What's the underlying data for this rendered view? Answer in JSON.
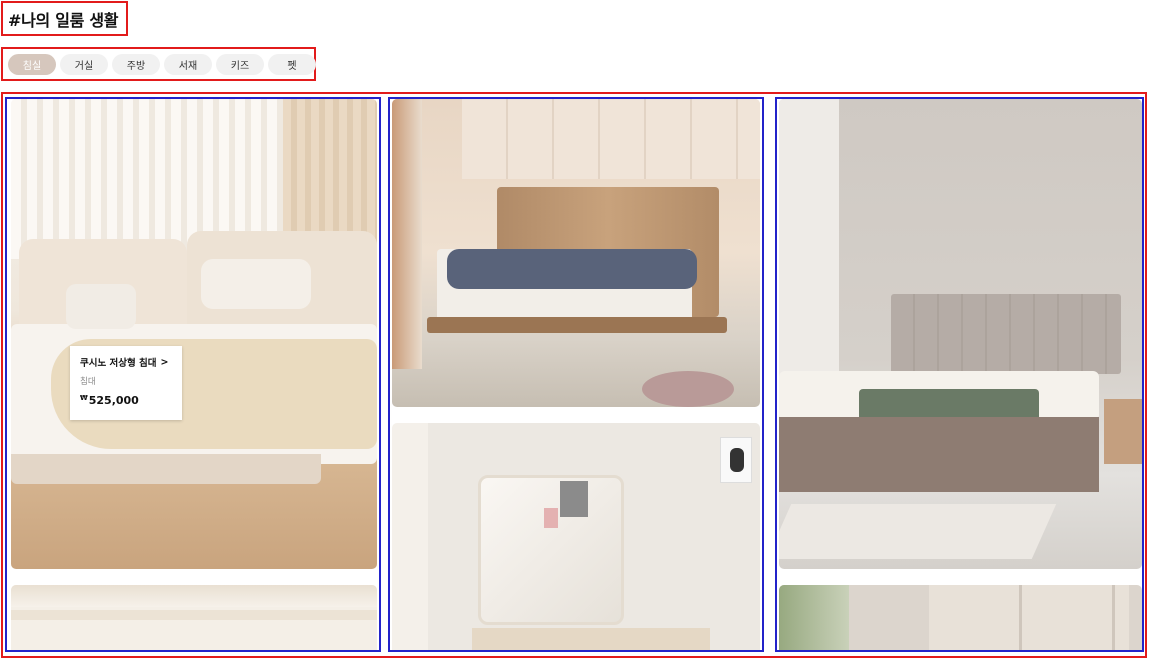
{
  "header": {
    "title": "#나의 일룸 생활"
  },
  "tabs": [
    {
      "label": "침실",
      "active": true
    },
    {
      "label": "거실",
      "active": false
    },
    {
      "label": "주방",
      "active": false
    },
    {
      "label": "서재",
      "active": false
    },
    {
      "label": "키즈",
      "active": false
    },
    {
      "label": "펫",
      "active": false
    }
  ],
  "product_tag": {
    "name": "쿠시노 저상형 침대",
    "chevron": ">",
    "category": "침대",
    "currency": "₩",
    "price": "525,000"
  },
  "colors": {
    "accent_tab": "#d6c7bd",
    "tab_bg": "#f1f1f1",
    "annotation_red": "#e21b1b",
    "annotation_blue": "#2323c9"
  }
}
